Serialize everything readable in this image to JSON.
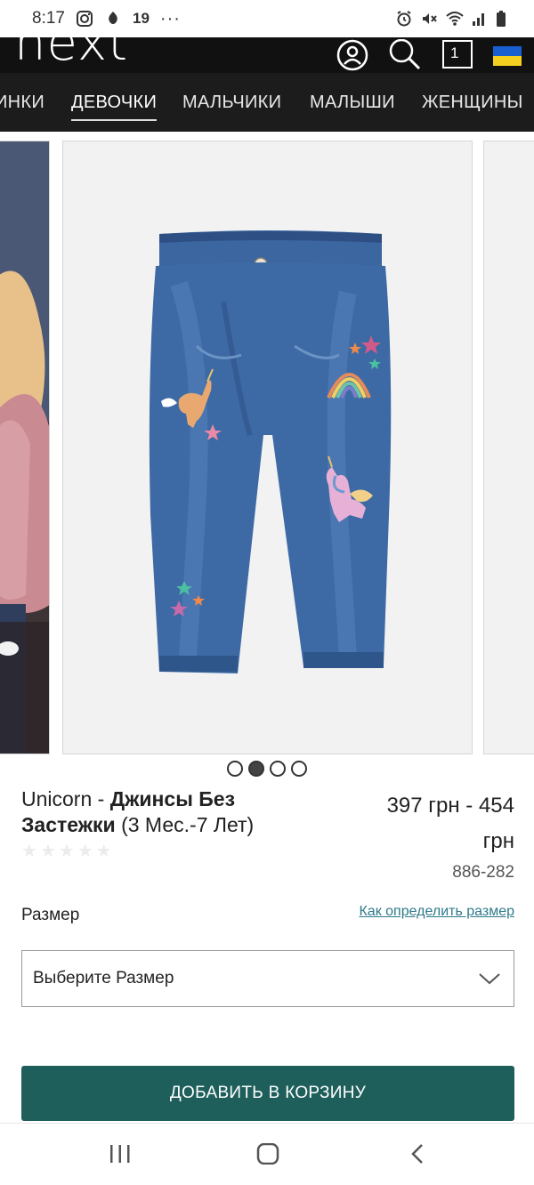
{
  "status_bar": {
    "time": "8:17",
    "notification_count": "19",
    "more": "···"
  },
  "header": {
    "logo": "next",
    "bag_count": "1"
  },
  "nav": {
    "items": [
      {
        "label": "ИНКИ"
      },
      {
        "label": "ДЕВОЧКИ"
      },
      {
        "label": "МАЛЬЧИКИ"
      },
      {
        "label": "МАЛЫШИ"
      },
      {
        "label": "ЖЕНЩИНЫ"
      }
    ]
  },
  "carousel": {
    "slide_count": 4,
    "active_index": 1
  },
  "product": {
    "title_brand": "Unicorn - ",
    "title_bold": "Джинсы Без Застежки",
    "title_suffix": " (3 Мес.-7 Лет)",
    "price_line1": "397 грн - 454",
    "price_line2": "грн",
    "sku": "886-282",
    "rating_stars": 0
  },
  "size": {
    "label": "Размер",
    "guide_link": "Как определить размер",
    "select_value": "Выберите Размер"
  },
  "cart": {
    "add_label": "ДОБАВИТЬ В КОРЗИНУ"
  },
  "colors": {
    "accent": "#1e5f5b",
    "link": "#2e7a8a",
    "header_bg": "#111111"
  }
}
